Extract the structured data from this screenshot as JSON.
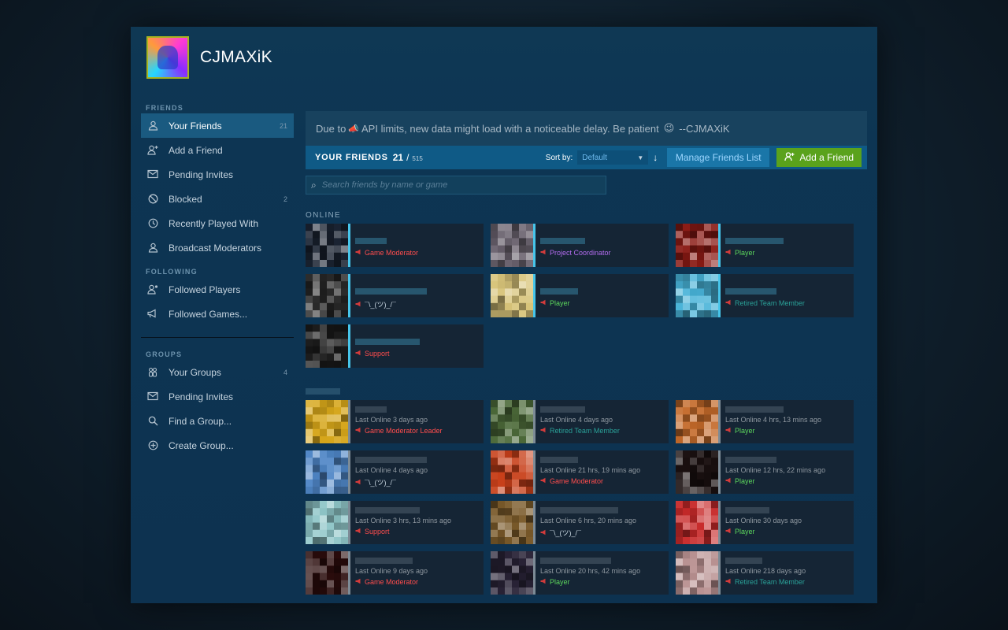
{
  "profile": {
    "username": "CJMAXiK"
  },
  "sidebar": {
    "friends_heading": "FRIENDS",
    "friends_items": [
      {
        "label": "Your Friends",
        "icon": "person-icon",
        "count": "21",
        "active": true
      },
      {
        "label": "Add a Friend",
        "icon": "add-person-icon",
        "count": ""
      },
      {
        "label": "Pending Invites",
        "icon": "envelope-icon",
        "count": ""
      },
      {
        "label": "Blocked",
        "icon": "blocked-icon",
        "count": "2"
      },
      {
        "label": "Recently Played With",
        "icon": "clock-icon",
        "count": ""
      },
      {
        "label": "Broadcast Moderators",
        "icon": "person-icon",
        "count": ""
      }
    ],
    "following_heading": "FOLLOWING",
    "following_items": [
      {
        "label": "Followed Players",
        "icon": "followed-person-icon"
      },
      {
        "label": "Followed Games...",
        "icon": "megaphone-icon"
      }
    ],
    "groups_heading": "GROUPS",
    "groups_items": [
      {
        "label": "Your Groups",
        "icon": "group-icon",
        "count": "4"
      },
      {
        "label": "Pending Invites",
        "icon": "envelope-icon",
        "count": ""
      },
      {
        "label": "Find a Group...",
        "icon": "search-icon",
        "count": ""
      },
      {
        "label": "Create Group...",
        "icon": "plus-circle-icon",
        "count": ""
      }
    ]
  },
  "notice": {
    "prefix": "Due to",
    "text": "API limits, new data might load with a noticeable delay. Be patient",
    "emoji": "😉",
    "suffix": "--CJMAXiK"
  },
  "toolbar": {
    "title": "YOUR FRIENDS",
    "count": "21",
    "separator": "/",
    "max": "515",
    "sort_label": "Sort by:",
    "sort_value": "Default",
    "sort_direction": "↓",
    "manage_label": "Manage Friends List",
    "add_label": "Add a Friend"
  },
  "search": {
    "placeholder": "Search friends by name or game"
  },
  "online": {
    "heading": "ONLINE",
    "friends": [
      {
        "role": "Game Moderator",
        "role_color": "#ff4d4d",
        "bg": "#1b2433"
      },
      {
        "role": "Project Coordinator",
        "role_color": "#b46cf0",
        "bg": "#6c6470"
      },
      {
        "role": "Player",
        "role_color": "#5cd65c",
        "bg": "#8a1a14"
      },
      {
        "role": "¯\\_(ツ)_/¯",
        "role_color": "#c6d4df",
        "bg": "#2a2a2a"
      },
      {
        "role": "Player",
        "role_color": "#5cd65c",
        "bg": "#d8c47a"
      },
      {
        "role": "Retired Team Member",
        "role_color": "#2aa198",
        "bg": "#48b3d8"
      },
      {
        "role": "Support",
        "role_color": "#ff4d4d",
        "bg": "#1e1e1e"
      }
    ]
  },
  "offline": {
    "friends": [
      {
        "status": "Last Online 3 days ago",
        "role": "Game Moderator Leader",
        "role_color": "#ff4d4d",
        "bg": "#d6a61a"
      },
      {
        "status": "Last Online 4 days ago",
        "role": "Retired Team Member",
        "role_color": "#2aa198",
        "bg": "#4d6b3a"
      },
      {
        "status": "Last Online 4 hrs, 13 mins ago",
        "role": "Player",
        "role_color": "#5cd65c",
        "bg": "#c46a2a"
      },
      {
        "status": "Last Online 4 days ago",
        "role": "¯\\_(ツ)_/¯",
        "role_color": "#c6d4df",
        "bg": "#4f86c6"
      },
      {
        "status": "Last Online 21 hrs, 19 mins ago",
        "role": "Game Moderator",
        "role_color": "#ff4d4d",
        "bg": "#c8401a"
      },
      {
        "status": "Last Online 12 hrs, 22 mins ago",
        "role": "Player",
        "role_color": "#5cd65c",
        "bg": "#1a1010"
      },
      {
        "status": "Last Online 3 hrs, 13 mins ago",
        "role": "Support",
        "role_color": "#ff4d4d",
        "bg": "#8fc6c8"
      },
      {
        "status": "Last Online 6 hrs, 20 mins ago",
        "role": "¯\\_(ツ)_/¯",
        "role_color": "#c6d4df",
        "bg": "#7a5a2a"
      },
      {
        "status": "Last Online 30 days ago",
        "role": "Player",
        "role_color": "#5cd65c",
        "bg": "#c82a2a"
      },
      {
        "status": "Last Online 9 days ago",
        "role": "Game Moderator",
        "role_color": "#ff4d4d",
        "bg": "#2a0c0c"
      },
      {
        "status": "Last Online 20 hrs, 42 mins ago",
        "role": "Player",
        "role_color": "#5cd65c",
        "bg": "#2a2438"
      },
      {
        "status": "Last Online 218 days ago",
        "role": "Retired Team Member",
        "role_color": "#2aa198",
        "bg": "#b89090"
      }
    ]
  }
}
